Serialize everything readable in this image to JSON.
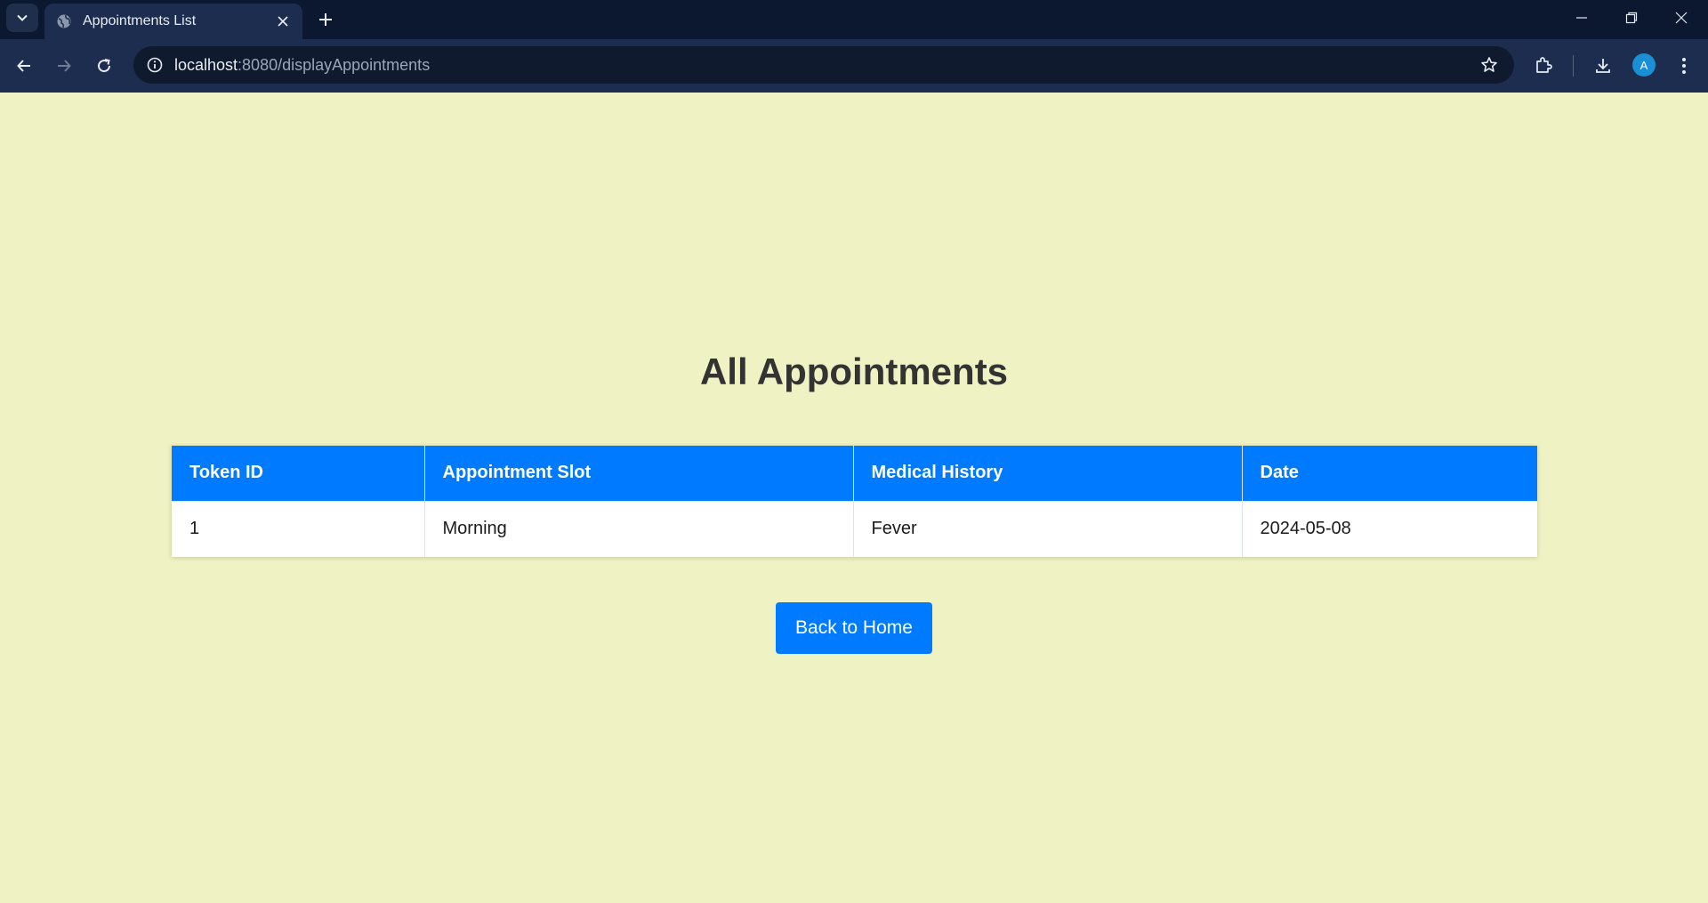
{
  "browser": {
    "tab_title": "Appointments List",
    "url_host": "localhost",
    "url_rest": ":8080/displayAppointments",
    "profile_initial": "A"
  },
  "page": {
    "title": "All Appointments",
    "table": {
      "headers": [
        "Token ID",
        "Appointment Slot",
        "Medical History",
        "Date"
      ],
      "rows": [
        [
          "1",
          "Morning",
          "Fever",
          "2024-05-08"
        ]
      ]
    },
    "back_button_label": "Back to Home"
  },
  "colors": {
    "page_background": "#eff3c3",
    "accent": "#007bff",
    "chrome_background": "#0e1b33"
  },
  "icons": [
    "tab-search-icon",
    "globe-icon",
    "close-icon",
    "plus-icon",
    "minimize-icon",
    "restore-icon",
    "window-close-icon",
    "back-arrow-icon",
    "forward-arrow-icon",
    "reload-icon",
    "info-icon",
    "star-icon",
    "extensions-icon",
    "download-icon",
    "kebab-menu-icon"
  ]
}
